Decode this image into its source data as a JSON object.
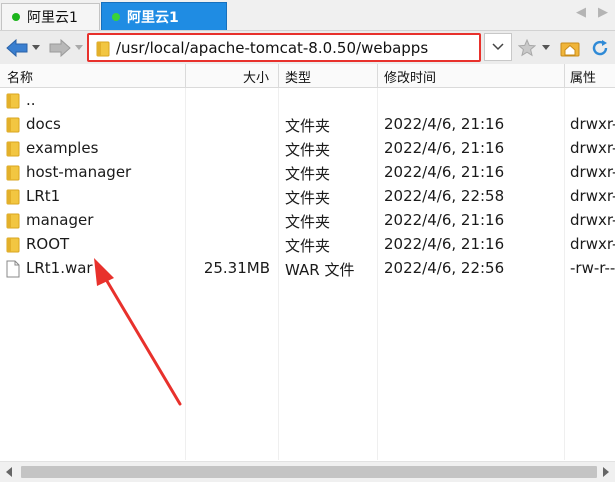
{
  "tabs": [
    {
      "label": "阿里云1",
      "active": false
    },
    {
      "label": "阿里云1",
      "active": true
    }
  ],
  "toolbar": {
    "path": "/usr/local/apache-tomcat-8.0.50/webapps"
  },
  "columns": {
    "name": "名称",
    "size": "大小",
    "type": "类型",
    "modified": "修改时间",
    "attr": "属性"
  },
  "parent_row": {
    "name": ".."
  },
  "files": [
    {
      "name": "docs",
      "size": "",
      "type": "文件夹",
      "modified": "2022/4/6, 21:16",
      "attr": "drwxr-",
      "icon": "folder-icon"
    },
    {
      "name": "examples",
      "size": "",
      "type": "文件夹",
      "modified": "2022/4/6, 21:16",
      "attr": "drwxr-",
      "icon": "folder-icon"
    },
    {
      "name": "host-manager",
      "size": "",
      "type": "文件夹",
      "modified": "2022/4/6, 21:16",
      "attr": "drwxr-",
      "icon": "folder-icon"
    },
    {
      "name": "LRt1",
      "size": "",
      "type": "文件夹",
      "modified": "2022/4/6, 22:58",
      "attr": "drwxr-",
      "icon": "folder-icon"
    },
    {
      "name": "manager",
      "size": "",
      "type": "文件夹",
      "modified": "2022/4/6, 21:16",
      "attr": "drwxr-",
      "icon": "folder-icon"
    },
    {
      "name": "ROOT",
      "size": "",
      "type": "文件夹",
      "modified": "2022/4/6, 21:16",
      "attr": "drwxr-",
      "icon": "folder-icon"
    },
    {
      "name": "LRt1.war",
      "size": "25.31MB",
      "type": "WAR 文件",
      "modified": "2022/4/6, 22:56",
      "attr": "-rw-r--",
      "icon": "file-icon"
    }
  ],
  "colors": {
    "active_tab": "#1f8ce3",
    "highlight": "#e8312c",
    "folder": "#f2c641"
  }
}
